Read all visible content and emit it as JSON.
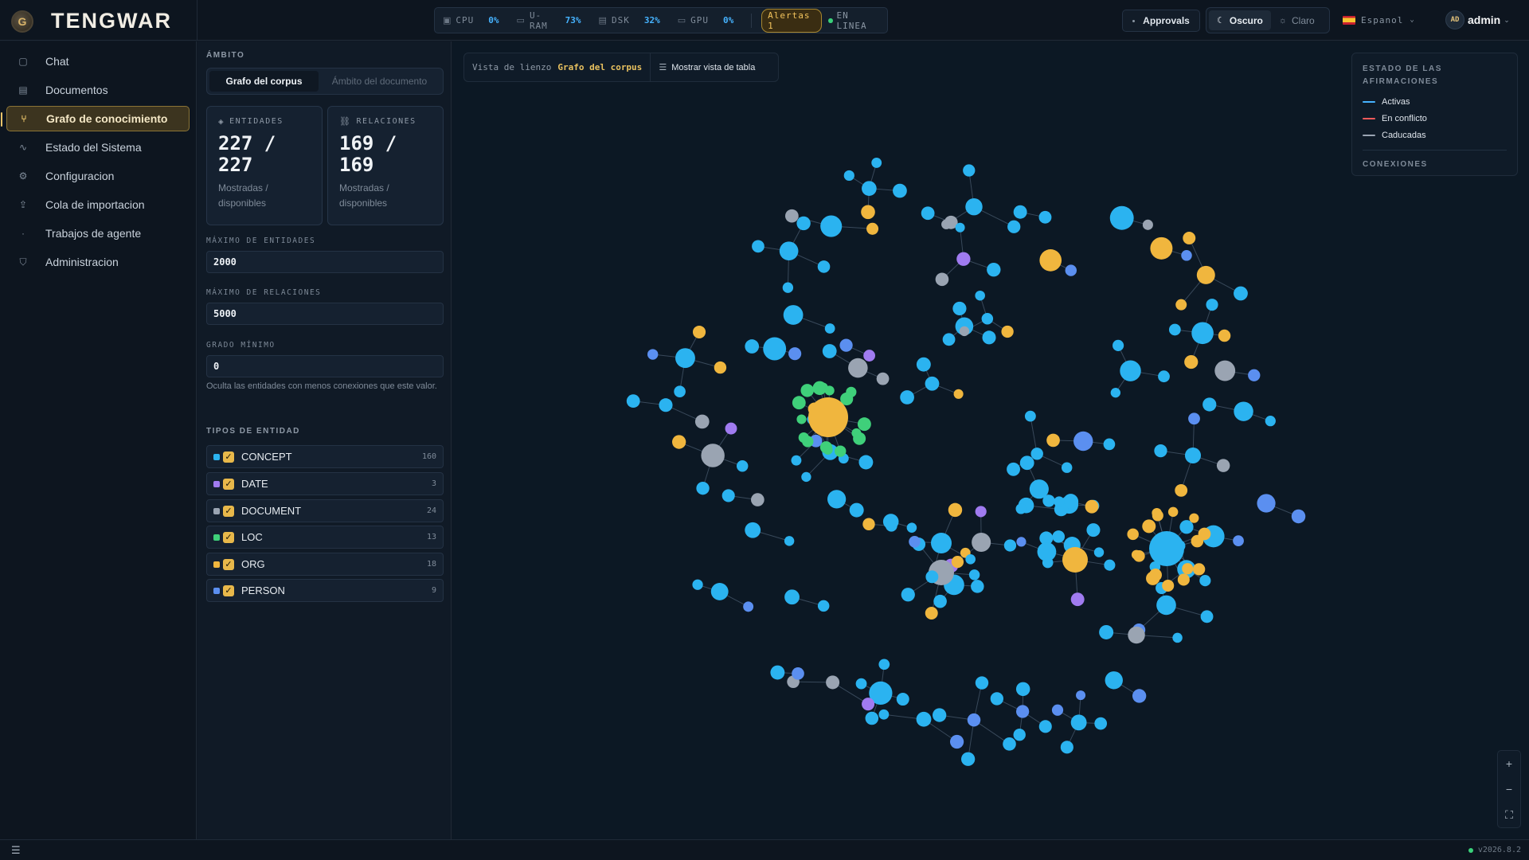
{
  "app": {
    "name": "TENGWAR",
    "logo_letter": "G",
    "version": "v2026.8.2"
  },
  "metrics": [
    {
      "label": "CPU",
      "value": "0%",
      "icon": "cpu-icon"
    },
    {
      "label": "U-RAM",
      "value": "73%",
      "icon": "ram-icon"
    },
    {
      "label": "DSK",
      "value": "32%",
      "icon": "disk-icon"
    },
    {
      "label": "GPU",
      "value": "0%",
      "icon": "gpu-icon"
    }
  ],
  "alerts_label": "Alertas 1",
  "status_label": "EN LINEA",
  "approvals_label": "Approvals",
  "theme": {
    "dark_label": "Oscuro",
    "light_label": "Claro",
    "selected": "Oscuro"
  },
  "language": {
    "selected": "Espanol"
  },
  "user": {
    "initials": "AD",
    "name": "admin"
  },
  "nav": [
    {
      "label": "Chat",
      "icon": "chat-icon"
    },
    {
      "label": "Documentos",
      "icon": "document-icon"
    },
    {
      "label": "Grafo de conocimiento",
      "icon": "graph-icon",
      "active": true
    },
    {
      "label": "Estado del Sistema",
      "icon": "activity-icon"
    },
    {
      "label": "Configuracion",
      "icon": "gear-icon"
    },
    {
      "label": "Cola de importacion",
      "icon": "upload-icon"
    },
    {
      "label": "Trabajos de agente",
      "icon": "dot-icon"
    },
    {
      "label": "Administracion",
      "icon": "shield-icon"
    }
  ],
  "panel": {
    "scope_label": "ÁMBITO",
    "tabs": [
      {
        "label": "Grafo del corpus",
        "active": true
      },
      {
        "label": "Ámbito del documento",
        "active": false
      }
    ],
    "entities_card": {
      "title": "ENTIDADES",
      "value": "227 / 227",
      "sub": "Mostradas / disponibles"
    },
    "relations_card": {
      "title": "RELACIONES",
      "value": "169 / 169",
      "sub": "Mostradas / disponibles"
    },
    "max_entities_label": "MÁXIMO DE ENTIDADES",
    "max_entities_value": "2000",
    "max_relations_label": "MÁXIMO DE RELACIONES",
    "max_relations_value": "5000",
    "min_degree_label": "GRADO MÍNIMO",
    "min_degree_value": "0",
    "min_degree_help": "Oculta las entidades con menos conexiones que este valor.",
    "entity_types_label": "TIPOS DE ENTIDAD",
    "entity_types": [
      {
        "name": "CONCEPT",
        "count": "160",
        "color": "#2bb3f0",
        "checked": true
      },
      {
        "name": "DATE",
        "count": "3",
        "color": "#a07bf0",
        "checked": true
      },
      {
        "name": "DOCUMENT",
        "count": "24",
        "color": "#9aa4b2",
        "checked": true
      },
      {
        "name": "LOC",
        "count": "13",
        "color": "#3fd07a",
        "checked": true
      },
      {
        "name": "ORG",
        "count": "18",
        "color": "#f0b63e",
        "checked": true
      },
      {
        "name": "PERSON",
        "count": "9",
        "color": "#5b8ff0",
        "checked": true
      }
    ]
  },
  "canvas": {
    "view_label": "Vista de lienzo",
    "view_value": "Grafo del corpus",
    "table_button": "Mostrar vista de tabla",
    "legend": {
      "title": "ESTADO DE LAS AFIRMACIONES",
      "items": [
        {
          "label": "Activas",
          "color": "#46b3ff"
        },
        {
          "label": "En conflicto",
          "color": "#f05a5a"
        },
        {
          "label": "Caducadas",
          "color": "#9aa4b2"
        }
      ],
      "connections_label": "CONEXIONES"
    },
    "zoom_in": "+",
    "zoom_out": "−",
    "fit": "⛶"
  },
  "footer_menu": "☰"
}
